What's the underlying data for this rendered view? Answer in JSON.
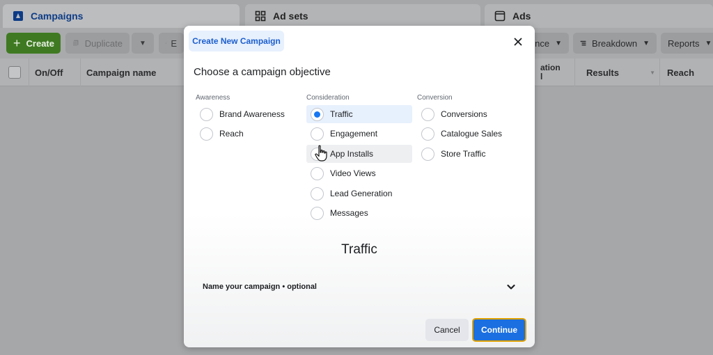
{
  "tabs": {
    "campaigns": "Campaigns",
    "adsets": "Ad sets",
    "ads": "Ads"
  },
  "toolbar": {
    "create": "Create",
    "duplicate": "Duplicate",
    "edit_partial": "E",
    "audience_partial": "ence",
    "breakdown": "Breakdown",
    "reports": "Reports"
  },
  "table": {
    "headers": {
      "onoff": "On/Off",
      "campaign_name": "Campaign name",
      "optimisation_partial_1": "ation",
      "optimisation_partial_2": "l",
      "results": "Results",
      "reach": "Reach"
    }
  },
  "modal": {
    "tab_label": "Create New Campaign",
    "heading": "Choose a campaign objective",
    "columns": [
      {
        "label": "Awareness",
        "options": [
          "Brand Awareness",
          "Reach"
        ]
      },
      {
        "label": "Consideration",
        "options": [
          "Traffic",
          "Engagement",
          "App Installs",
          "Video Views",
          "Lead Generation",
          "Messages"
        ]
      },
      {
        "label": "Conversion",
        "options": [
          "Conversions",
          "Catalogue Sales",
          "Store Traffic"
        ]
      }
    ],
    "selected": "Traffic",
    "hovered": "App Installs",
    "preview_title": "Traffic",
    "name_campaign_label": "Name your campaign • optional",
    "cancel": "Cancel",
    "continue": "Continue"
  },
  "colors": {
    "accent": "#1877f2",
    "continue_button": "#1b6fe0",
    "continue_focus_ring": "#e0a100",
    "create_button": "#3f7a22"
  },
  "icons": {
    "campaigns_tab": "campaign-folder-icon",
    "adsets_tab": "grid-icon",
    "ads_tab": "window-icon",
    "close": "close-icon",
    "expand": "chevron-down-icon",
    "cursor": "hand-pointer-icon"
  }
}
